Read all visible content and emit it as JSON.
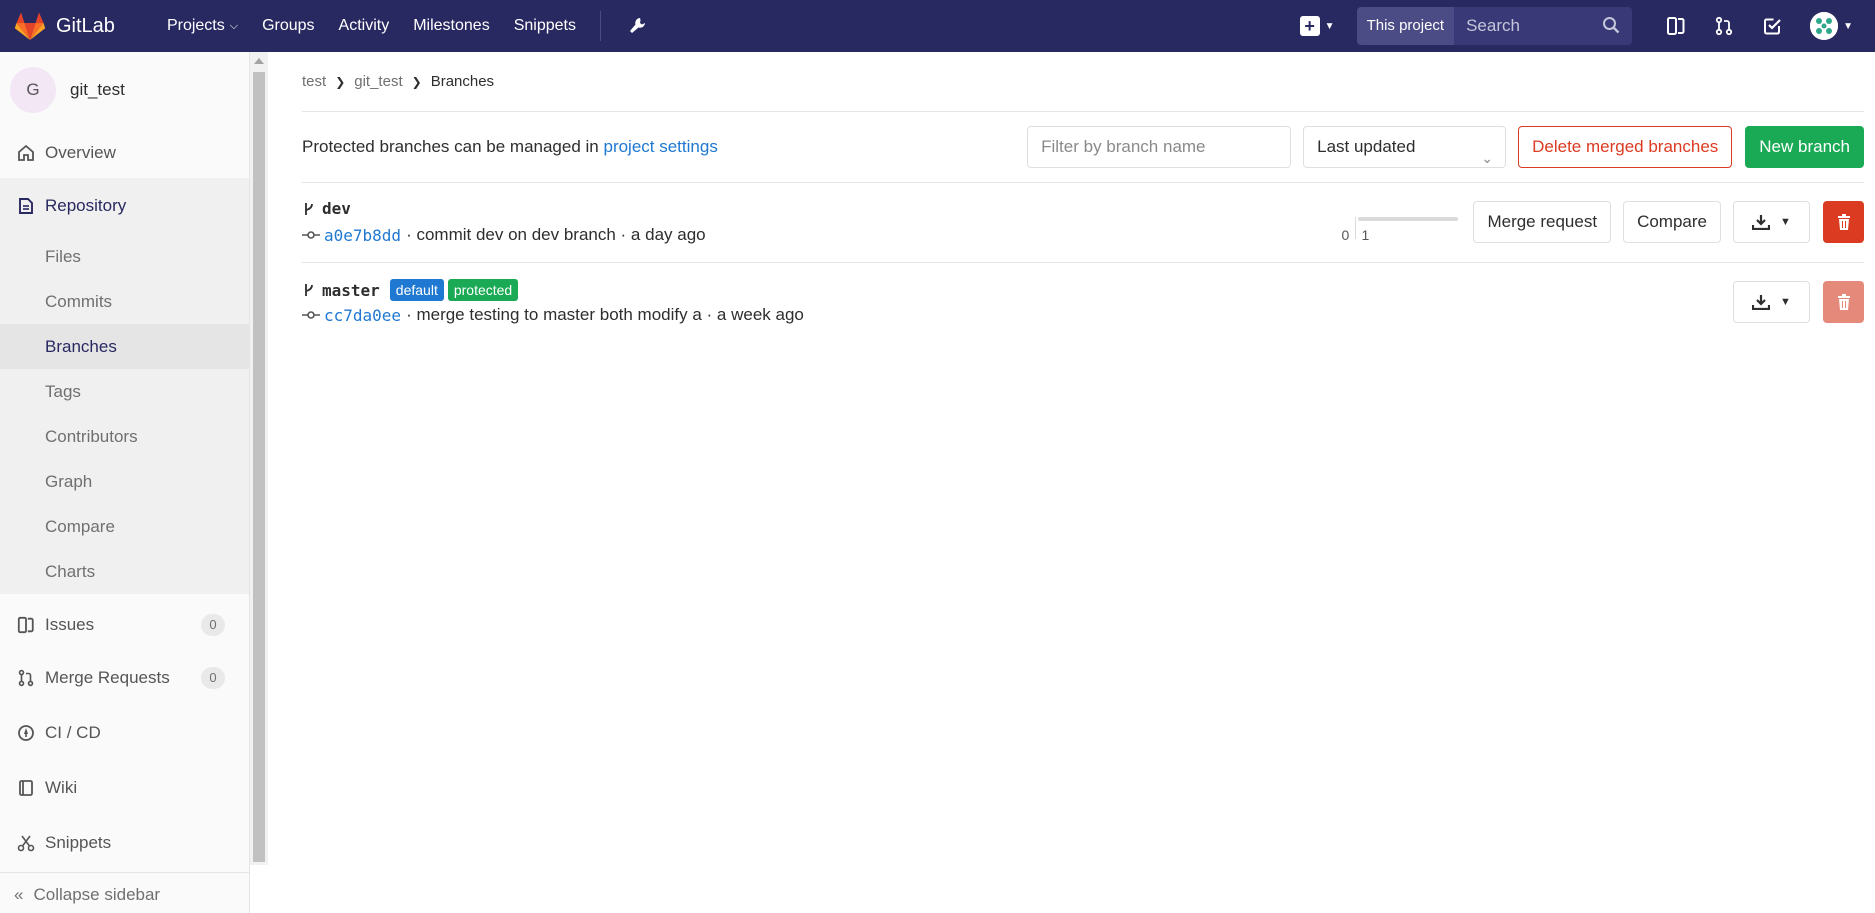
{
  "navbar": {
    "brand": "GitLab",
    "links": [
      "Projects",
      "Groups",
      "Activity",
      "Milestones",
      "Snippets"
    ],
    "search_scope": "This project",
    "search_placeholder": "Search"
  },
  "sidebar": {
    "project_initial": "G",
    "project_name": "git_test",
    "overview": "Overview",
    "repository": "Repository",
    "repo_items": [
      "Files",
      "Commits",
      "Branches",
      "Tags",
      "Contributors",
      "Graph",
      "Compare",
      "Charts"
    ],
    "issues": "Issues",
    "issues_count": "0",
    "merge_requests": "Merge Requests",
    "mr_count": "0",
    "cicd": "CI / CD",
    "wiki": "Wiki",
    "snippets": "Snippets",
    "collapse": "Collapse sidebar"
  },
  "breadcrumb": [
    "test",
    "git_test",
    "Branches"
  ],
  "toolbar": {
    "info_text": "Protected branches can be managed in ",
    "info_link": "project settings",
    "filter_placeholder": "Filter by branch name",
    "sort_value": "Last updated",
    "delete_merged": "Delete merged branches",
    "new_branch": "New branch"
  },
  "branches": [
    {
      "name": "dev",
      "sha": "a0e7b8dd",
      "message": "· commit dev on dev branch · a day ago",
      "behind": "0",
      "ahead": "1",
      "merge_request": "Merge request",
      "compare": "Compare"
    },
    {
      "name": "master",
      "labels": [
        "default",
        "protected"
      ],
      "sha": "cc7da0ee",
      "message": "· merge testing to master both modify a · a week ago"
    }
  ],
  "colors": {
    "navbar": "#292961",
    "link": "#1f78d1",
    "success": "#1aaa55",
    "danger": "#db3b21"
  }
}
